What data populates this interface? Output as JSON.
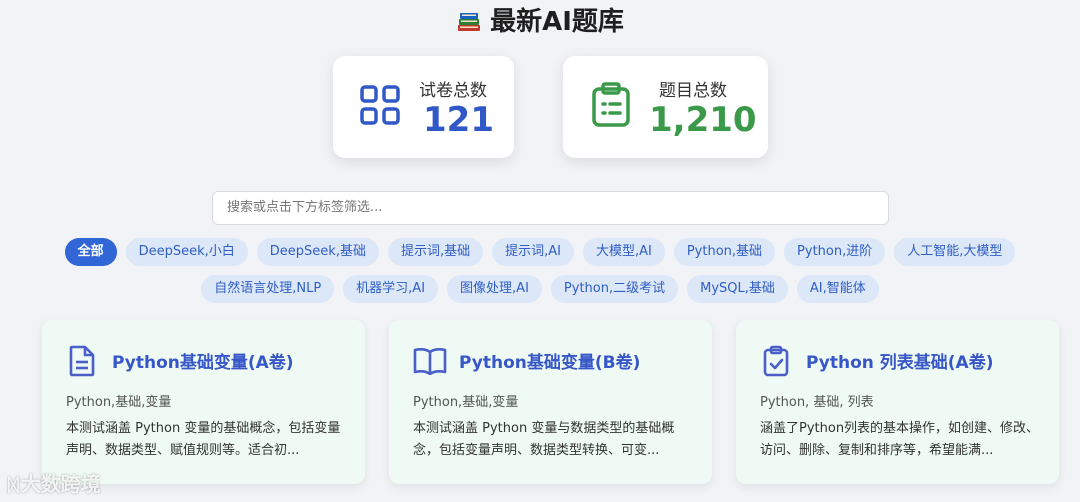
{
  "header": {
    "icon": "books-icon",
    "title": "最新AI题库"
  },
  "stats": {
    "papers": {
      "label": "试卷总数",
      "value": "121",
      "icon": "grid-icon",
      "color": "#3158c7"
    },
    "questions": {
      "label": "题目总数",
      "value": "1,210",
      "icon": "clipboard-icon",
      "color": "#3a9a4a"
    }
  },
  "search": {
    "placeholder": "搜索或点击下方标签筛选..."
  },
  "tags": {
    "row1": [
      "全部",
      "DeepSeek,小白",
      "DeepSeek,基础",
      "提示词,基础",
      "提示词,AI",
      "大模型,AI",
      "Python,基础",
      "Python,进阶",
      "人工智能,大模型"
    ],
    "row2": [
      "自然语言处理,NLP",
      "机器学习,AI",
      "图像处理,AI",
      "Python,二级考试",
      "MySQL,基础",
      "AI,智能体"
    ],
    "active": "全部"
  },
  "cards": [
    {
      "icon": "document-icon",
      "title": "Python基础变量(A卷)",
      "tags": "Python,基础,变量",
      "desc": "本测试涵盖 Python 变量的基础概念，包括变量声明、数据类型、赋值规则等。适合初..."
    },
    {
      "icon": "book-open-icon",
      "title": "Python基础变量(B卷)",
      "tags": "Python,基础,变量",
      "desc": "本测试涵盖 Python 变量与数据类型的基础概念，包括变量声明、数据类型转换、可变..."
    },
    {
      "icon": "clipboard-check-icon",
      "title": "Python 列表基础(A卷)",
      "tags": "Python, 基础, 列表",
      "desc": "涵盖了Python列表的基本操作，如创建、修改、访问、删除、复制和排序等，希望能满..."
    }
  ],
  "watermark": {
    "text": "大数跨境"
  },
  "colors": {
    "accent": "#3166d6",
    "tag_bg": "#dce7f8",
    "card_bg": "#eefaf3",
    "title_blue": "#3757c8"
  }
}
